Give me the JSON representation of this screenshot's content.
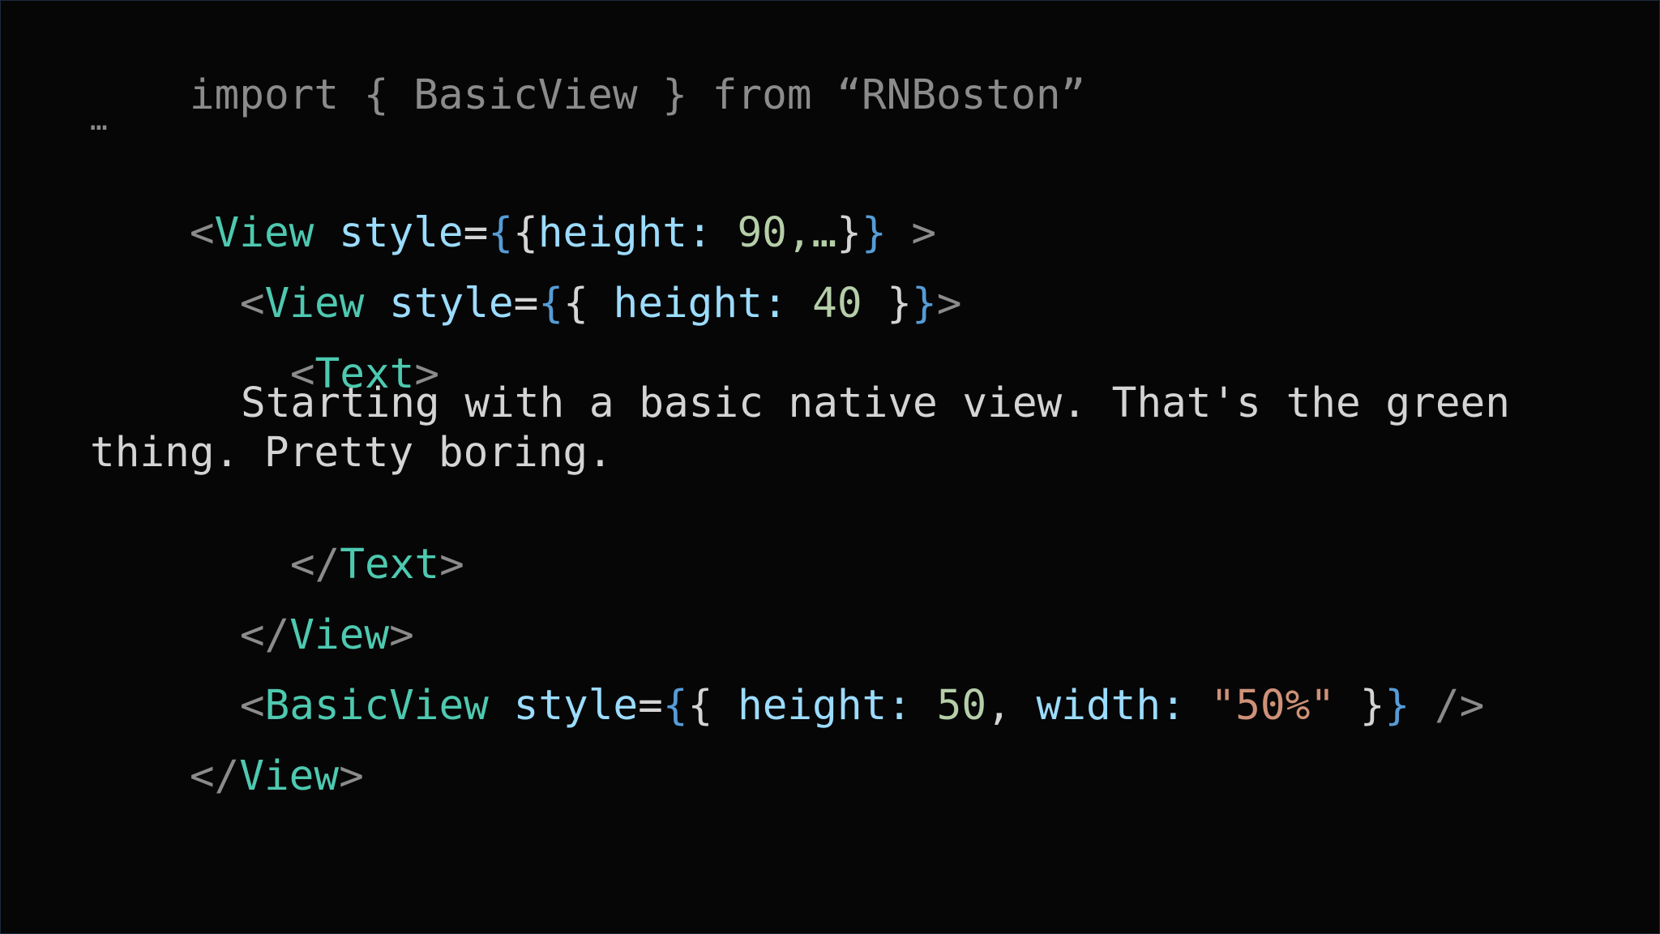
{
  "code": {
    "import_line": {
      "kw_import": "import",
      "open_brace": "{",
      "name": "BasicView",
      "close_brace": "}",
      "kw_from": "from",
      "module": "“RNBoston”"
    },
    "ellipsis": "…",
    "view_open": {
      "lt": "<",
      "tag": "View",
      "attr": "style",
      "eq": "=",
      "brace_open": "{",
      "inner_open": "{",
      "key": "height:",
      "value": "90,…",
      "inner_close": "}",
      "brace_close": "}",
      "gt": ">"
    },
    "inner_view_open": {
      "lt": "<",
      "tag": "View",
      "attr": "style",
      "eq": "=",
      "brace_open": "{",
      "inner_open": "{",
      "key": "height:",
      "value": "40",
      "inner_close": "}",
      "brace_close": "}",
      "gt": ">"
    },
    "text_open": {
      "lt": "<",
      "tag": "Text",
      "gt": ">"
    },
    "text_content_line1": "Starting with a basic native view. That's the green",
    "text_content_line2": "thing. Pretty boring.",
    "text_close": {
      "lt": "</",
      "tag": "Text",
      "gt": ">"
    },
    "inner_view_close": {
      "lt": "</",
      "tag": "View",
      "gt": ">"
    },
    "basic_view": {
      "lt": "<",
      "tag": "BasicView",
      "attr": "style",
      "eq": "=",
      "brace_open": "{",
      "inner_open": "{",
      "key1": "height:",
      "value1": "50",
      "comma": ",",
      "key2": "width:",
      "value2": "\"50%\"",
      "inner_close": "}",
      "brace_close": "}",
      "self_close": "/>"
    },
    "view_close": {
      "lt": "</",
      "tag": "View",
      "gt": ">"
    }
  },
  "colors": {
    "background": "#060607",
    "tag": "#4ec9b0",
    "attribute": "#9cdcfe",
    "brace": "#569cd6",
    "number": "#b5cea8",
    "string": "#ce9178",
    "punctuation": "#8b8b8b"
  }
}
